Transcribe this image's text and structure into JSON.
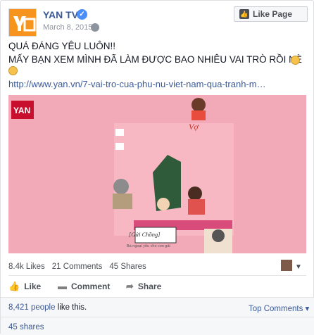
{
  "post": {
    "page_name": "YAN TV",
    "date": "March 8, 2015",
    "like_page_label": "Like Page",
    "message_line1": "QUÁ ĐÁNG YÊU LUÔN!!",
    "message_line2": "MẤY BẠN XEM MÌNH ĐÃ LÀM ĐƯỢC BAO NHIÊU VAI TRÒ RỒI NÈ",
    "link_text": "http://www.yan.vn/7-vai-tro-cua-phu-nu-viet-nam-qua-tranh-m…"
  },
  "media": {
    "label_vo": "Vợ",
    "label_gui_chong": "[Gửi Chồng]",
    "label_caption": "Ba ngoại yêu cho con gái"
  },
  "stats": {
    "likes": "8.4k Likes",
    "comments": "21 Comments",
    "shares": "45 Shares"
  },
  "actions": {
    "like": "Like",
    "comment": "Comment",
    "share": "Share"
  },
  "footer": {
    "likes_count": "8,421 people",
    "likes_suffix": " like this.",
    "top_comments": "Top Comments ▾",
    "shares": "45 shares"
  },
  "colors": {
    "link": "#3b5998",
    "brand_orange": "#f7941d",
    "image_pink": "#f3aab8"
  },
  "icons": [
    "yan-logo-icon",
    "verified-icon",
    "globe-icon",
    "thumbs-up-icon",
    "smile-emoji-icon",
    "comment-icon",
    "share-icon",
    "caret-down-icon"
  ]
}
